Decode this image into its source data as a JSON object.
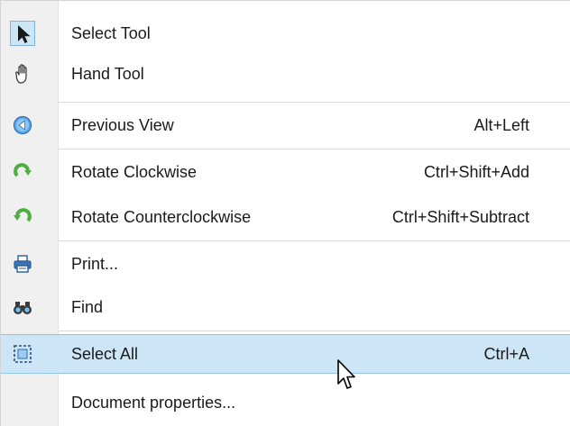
{
  "menu": {
    "items": [
      {
        "label": "Select Tool",
        "shortcut": "",
        "icon": "arrow-pointer-icon",
        "checked": true
      },
      {
        "label": "Hand Tool",
        "shortcut": "",
        "icon": "hand-icon"
      },
      {
        "label": "Previous View",
        "shortcut": "Alt+Left",
        "icon": "back-arrow-circle-icon"
      },
      {
        "label": "Rotate Clockwise",
        "shortcut": "Ctrl+Shift+Add",
        "icon": "rotate-clockwise-icon"
      },
      {
        "label": "Rotate Counterclockwise",
        "shortcut": "Ctrl+Shift+Subtract",
        "icon": "rotate-counterclockwise-icon"
      },
      {
        "label": "Print...",
        "shortcut": "",
        "icon": "printer-icon"
      },
      {
        "label": "Find",
        "shortcut": "",
        "icon": "binoculars-icon"
      },
      {
        "label": "Select All",
        "shortcut": "Ctrl+A",
        "icon": "select-all-icon",
        "highlighted": true
      },
      {
        "label": "Document properties...",
        "shortcut": "",
        "icon": ""
      }
    ]
  },
  "colors": {
    "highlight": "#cde6f7",
    "highlight_border": "#8fc3ea",
    "gutter": "#f0f0f0"
  }
}
